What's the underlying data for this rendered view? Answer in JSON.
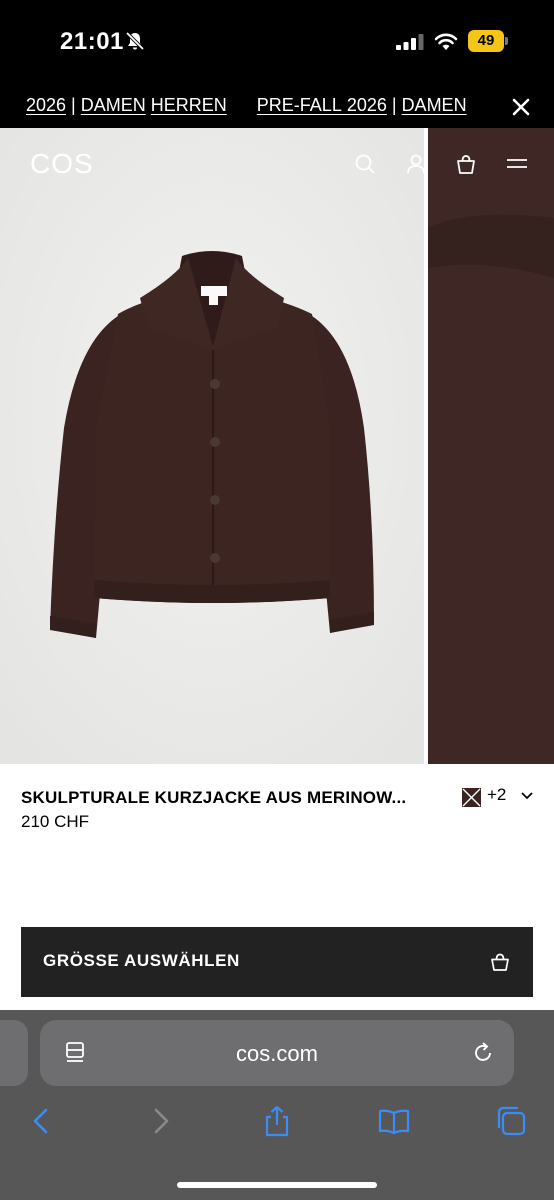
{
  "status_bar": {
    "time": "21:01",
    "battery_level": "49",
    "icons": [
      "bell-slash-icon",
      "signal-icon",
      "wifi-icon",
      "battery-icon"
    ]
  },
  "promo": {
    "segments": [
      {
        "text": "2026",
        "link": true
      },
      {
        "text": " | ",
        "link": false
      },
      {
        "text": "DAMEN",
        "link": true
      },
      {
        "text": " ",
        "link": false
      },
      {
        "text": "HERREN",
        "link": true
      },
      {
        "text": "      ",
        "link": false
      },
      {
        "text": "PRE-FALL 2026",
        "link": true
      },
      {
        "text": " | ",
        "link": false
      },
      {
        "text": "DAMEN",
        "link": true
      }
    ],
    "close_icon": "close-icon"
  },
  "header": {
    "logo": "COS",
    "icons": [
      "search-icon",
      "account-icon",
      "bag-icon",
      "menu-icon"
    ]
  },
  "gallery": {
    "image": "Dark brown knit button-up jacket with collar",
    "slide_count": 2,
    "active_slide": 1,
    "expand_icon": "expand-icon",
    "wishlist_icon": "heart-icon"
  },
  "product": {
    "title": "SKULPTURALE KURZJACKE AUS MERINOW...",
    "price": "210 CHF",
    "more_colors": "+2",
    "size_button": "GRÖSSE AUSWÄHLEN"
  },
  "browser": {
    "url": "cos.com",
    "toolbar_icons": [
      "back-icon",
      "forward-icon",
      "share-icon",
      "bookmarks-icon",
      "tabs-icon"
    ]
  },
  "colors": {
    "jacket": "#3b2320",
    "button_dark": "#222222",
    "safari_accent": "#3a8df5",
    "battery": "#f5c518"
  }
}
